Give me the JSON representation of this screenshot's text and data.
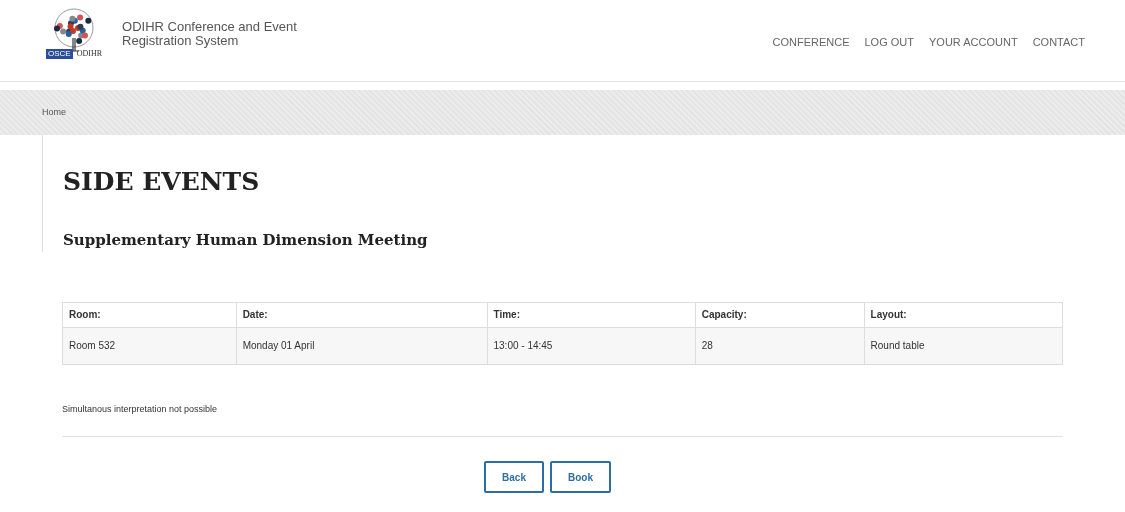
{
  "header": {
    "logo": {
      "badge": "OSCE",
      "name": "ODIHR"
    },
    "title": "ODIHR Conference and Event Registration System",
    "nav": [
      "CONFERENCE",
      "LOG OUT",
      "YOUR ACCOUNT",
      "CONTACT"
    ]
  },
  "breadcrumb": [
    "Home"
  ],
  "page": {
    "title": "SIDE EVENTS",
    "subtitle": "Supplementary Human Dimension Meeting"
  },
  "table": {
    "columns": [
      "Room:",
      "Date:",
      "Time:",
      "Capacity:",
      "Layout:"
    ],
    "rows": [
      [
        "Room 532",
        "Monday 01 April",
        "13:00 - 14:45",
        "28",
        "Round table"
      ]
    ]
  },
  "note": "Simultanous interpretation not possible",
  "buttons": [
    "Back",
    "Book"
  ]
}
